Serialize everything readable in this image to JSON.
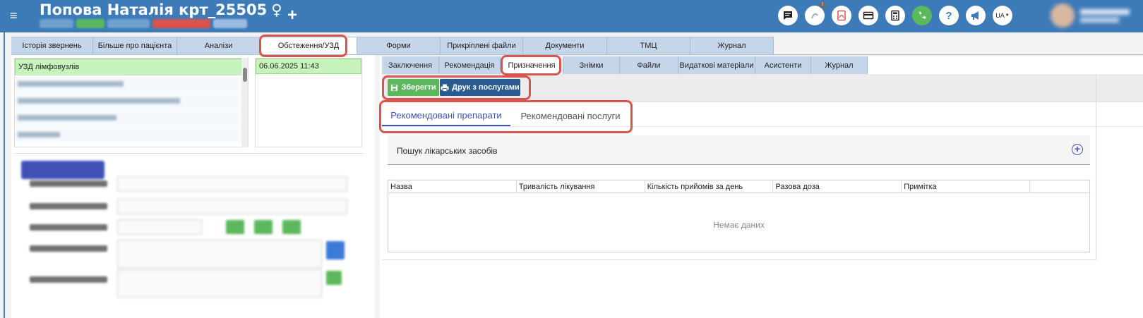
{
  "header": {
    "menu_icon": "≡",
    "patient_title": "Попова Наталія крт_25505",
    "sex_symbol": "♀",
    "add_icon": "+",
    "icons": [
      "chat-icon",
      "call-log-icon",
      "pdf-icon",
      "card-icon",
      "calculator-icon",
      "phone-icon",
      "help-icon",
      "announce-icon"
    ],
    "notification_count": "!",
    "language": "UA"
  },
  "main_tabs": [
    {
      "label": "Історія звернень"
    },
    {
      "label": "Більше про пацієнта"
    },
    {
      "label": "Аналізи"
    },
    {
      "label": "Обстеження/УЗД"
    },
    {
      "label": "Форми"
    },
    {
      "label": "Прикріплені файли"
    },
    {
      "label": "Документи"
    },
    {
      "label": "ТМЦ"
    },
    {
      "label": "Журнал"
    }
  ],
  "left": {
    "list_items": [
      {
        "label": "УЗД лімфовузлів"
      }
    ],
    "selected_date": "06.06.2025 11:43"
  },
  "sub_tabs": [
    {
      "label": "Заключення"
    },
    {
      "label": "Рекомендація"
    },
    {
      "label": "Призначення"
    },
    {
      "label": "Знімки"
    },
    {
      "label": "Файли"
    },
    {
      "label": "Видаткові матеріали"
    },
    {
      "label": "Асистенти"
    },
    {
      "label": "Журнал"
    }
  ],
  "toolbar": {
    "save_label": "Зберегти",
    "print_label": "Друк з послугами"
  },
  "inner_tabs": [
    {
      "label": "Рекомендовані препарати"
    },
    {
      "label": "Рекомендовані послуги"
    }
  ],
  "search": {
    "title": "Пошук лікарських засобів"
  },
  "table": {
    "columns": [
      "Назва",
      "Тривалість лікування",
      "Кількість прийомів за день",
      "Разова доза",
      "Примітка"
    ],
    "empty_text": "Немає даних"
  },
  "colors": {
    "header_bg": "#3d7ab8",
    "tab_bg": "#c6d6ea",
    "selected_row": "#c6f2bc",
    "save_button": "#5cb85c",
    "print_button": "#2a5a8f",
    "accent": "#3f51b5",
    "highlight": "#d9534f"
  }
}
